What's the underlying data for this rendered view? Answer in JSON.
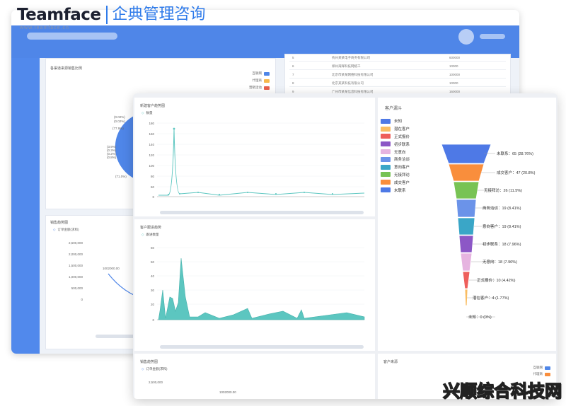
{
  "brand": {
    "name": "Teamface",
    "url": "www.teamface.cn",
    "tagline": "企典管理咨询"
  },
  "colors": {
    "primary": "#4f86e8",
    "teal": "#5cc6c0",
    "brand_blue": "#2f7bea"
  },
  "back_window": {
    "card_left_title": "各渠道来源销售比例",
    "card_left_legend": [
      {
        "label": "互联网",
        "color": "#4f86e8"
      },
      {
        "label": "代理商",
        "color": "#f7b84b"
      },
      {
        "label": "营销活动",
        "color": "#e8604c"
      }
    ],
    "pie_labels": [
      "(0.02%)",
      "(0.02%)",
      "(77.9%)",
      "(3.9%)",
      "(0.3%)",
      "(0.2%)",
      "(0.8%)",
      "(71.0%)"
    ],
    "table_rows": [
      {
        "no": "5",
        "company": "杭州某某电子商务有限公司",
        "amount": "600000"
      },
      {
        "no": "6",
        "company": "郑州海辉科技网络工",
        "amount": "10000"
      },
      {
        "no": "7",
        "company": "北京市某某网络科技有限公司",
        "amount": "100000"
      },
      {
        "no": "8",
        "company": "北京某某科技有限公司",
        "amount": "10000"
      },
      {
        "no": "9",
        "company": "广州市某某信息科技有限公司",
        "amount": "160000"
      }
    ],
    "sales_trend": {
      "title": "销售趋势图",
      "legend": "订单金额(求和)",
      "yticks": [
        "2,500,000",
        "2,000,000",
        "1,500,000",
        "1,000,000",
        "500,000",
        "0"
      ],
      "label": "1002000.00"
    }
  },
  "front_window": {
    "new_customers": {
      "title": "新建客户趋势图",
      "legend": "数量",
      "yticks": [
        "180",
        "160",
        "140",
        "120",
        "100",
        "80",
        "60",
        "40",
        "20",
        "0"
      ]
    },
    "followup": {
      "title": "客户跟进趋势",
      "legend": "跟进数量",
      "yticks": [
        "60",
        "50",
        "40",
        "30",
        "20",
        "10",
        "0"
      ]
    },
    "funnel": {
      "title": "客户漏斗",
      "legend": [
        {
          "label": "未知",
          "color": "#4e79e6"
        },
        {
          "label": "潜在客户",
          "color": "#f9bd63"
        },
        {
          "label": "正式报价",
          "color": "#ee5f5b"
        },
        {
          "label": "初步联系",
          "color": "#8c57c6"
        },
        {
          "label": "无意向",
          "color": "#e6b4e0"
        },
        {
          "label": "商务洽谈",
          "color": "#6b93e9"
        },
        {
          "label": "意向客户",
          "color": "#3aa6c7"
        },
        {
          "label": "无接拜访",
          "color": "#78c354"
        },
        {
          "label": "成交客户",
          "color": "#f98e3c"
        },
        {
          "label": "未联系",
          "color": "#4e79e6"
        }
      ],
      "stages": [
        {
          "label": "未联系：65 (28.76%)",
          "color": "#4e79e6"
        },
        {
          "label": "成交客户：47 (20.8%)",
          "color": "#f98e3c"
        },
        {
          "label": "无接拜访：26 (11.5%)",
          "color": "#78c354"
        },
        {
          "label": "商务洽谈：19 (8.41%)",
          "color": "#6b93e9"
        },
        {
          "label": "意向客户：19 (8.41%)",
          "color": "#3aa6c7"
        },
        {
          "label": "初步联系：18 (7.96%)",
          "color": "#8c57c6"
        },
        {
          "label": "无意向：18 (7.96%)",
          "color": "#e6b4e0"
        },
        {
          "label": "正式报价：10 (4.42%)",
          "color": "#ee5f5b"
        },
        {
          "label": "潜在客户：4 (1.77%)",
          "color": "#f9bd63"
        },
        {
          "label": "未知：0 (0%)",
          "color": "#4e79e6"
        }
      ]
    },
    "sales_trend": {
      "title": "销售趋势图",
      "legend": "订单金额(求和)",
      "ytick": "2,500,000",
      "label": "1002000.00"
    },
    "source": {
      "title": "客户来源",
      "legend": [
        {
          "label": "互联网",
          "color": "#4f86e8"
        },
        {
          "label": "代理商",
          "color": "#f98e3c"
        }
      ]
    }
  },
  "watermark": "兴顺综合科技网"
}
